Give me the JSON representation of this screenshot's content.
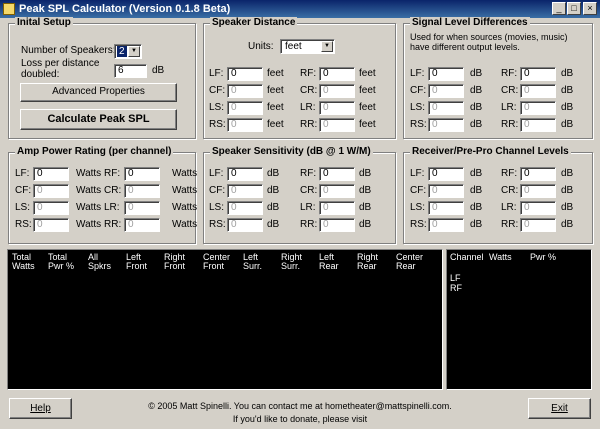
{
  "titlebar": {
    "title": "Peak SPL Calculator (Version 0.1.8 Beta)",
    "minimize": "_",
    "maximize": "□",
    "close": "×"
  },
  "setup": {
    "group_label": "Inital Setup",
    "num_speakers_label": "Number of Speakers:",
    "num_speakers_value": "2",
    "loss_label": "Loss per distance doubled:",
    "loss_value": "6",
    "loss_unit": "dB",
    "advanced_label": "Advanced Properties",
    "calculate_label": "Calculate Peak SPL"
  },
  "distance": {
    "group_label": "Speaker Distance",
    "units_label": "Units:",
    "units_value": "feet",
    "unit": "feet",
    "fields": [
      {
        "label": "LF:",
        "value": "0",
        "enabled": true
      },
      {
        "label": "RF:",
        "value": "0",
        "enabled": true
      },
      {
        "label": "CF:",
        "value": "0",
        "enabled": false
      },
      {
        "label": "CR:",
        "value": "0",
        "enabled": false
      },
      {
        "label": "LS:",
        "value": "0",
        "enabled": false
      },
      {
        "label": "LR:",
        "value": "0",
        "enabled": false
      },
      {
        "label": "RS:",
        "value": "0",
        "enabled": false
      },
      {
        "label": "RR:",
        "value": "0",
        "enabled": false
      }
    ]
  },
  "signal": {
    "group_label": "Signal Level Differences",
    "description": "Used for when sources (movies, music) have different output levels.",
    "unit": "dB",
    "fields": [
      {
        "label": "LF:",
        "value": "0",
        "enabled": true
      },
      {
        "label": "RF:",
        "value": "0",
        "enabled": true
      },
      {
        "label": "CF:",
        "value": "0",
        "enabled": false
      },
      {
        "label": "CR:",
        "value": "0",
        "enabled": false
      },
      {
        "label": "LS:",
        "value": "0",
        "enabled": false
      },
      {
        "label": "LR:",
        "value": "0",
        "enabled": false
      },
      {
        "label": "RS:",
        "value": "0",
        "enabled": false
      },
      {
        "label": "RR:",
        "value": "0",
        "enabled": false
      }
    ]
  },
  "amp": {
    "group_label": "Amp Power Rating  (per channel)",
    "unit": "Watts",
    "fields": [
      {
        "label": "LF:",
        "value": "0",
        "enabled": true
      },
      {
        "label": "RF:",
        "value": "0",
        "enabled": true
      },
      {
        "label": "CF:",
        "value": "0",
        "enabled": false
      },
      {
        "label": "CR:",
        "value": "0",
        "enabled": false
      },
      {
        "label": "LS:",
        "value": "0",
        "enabled": false
      },
      {
        "label": "LR:",
        "value": "0",
        "enabled": false
      },
      {
        "label": "RS:",
        "value": "0",
        "enabled": false
      },
      {
        "label": "RR:",
        "value": "0",
        "enabled": false
      }
    ]
  },
  "sensitivity": {
    "group_label": "Speaker Sensitivity (dB @ 1 W/M)",
    "unit": "dB",
    "fields": [
      {
        "label": "LF:",
        "value": "0",
        "enabled": true
      },
      {
        "label": "RF:",
        "value": "0",
        "enabled": true
      },
      {
        "label": "CF:",
        "value": "0",
        "enabled": false
      },
      {
        "label": "CR:",
        "value": "0",
        "enabled": false
      },
      {
        "label": "LS:",
        "value": "0",
        "enabled": false
      },
      {
        "label": "LR:",
        "value": "0",
        "enabled": false
      },
      {
        "label": "RS:",
        "value": "0",
        "enabled": false
      },
      {
        "label": "RR:",
        "value": "0",
        "enabled": false
      }
    ]
  },
  "receiver": {
    "group_label": "Receiver/Pre-Pro Channel Levels",
    "unit": "dB",
    "fields": [
      {
        "label": "LF:",
        "value": "0",
        "enabled": true
      },
      {
        "label": "RF:",
        "value": "0",
        "enabled": true
      },
      {
        "label": "CF:",
        "value": "0",
        "enabled": false
      },
      {
        "label": "CR:",
        "value": "0",
        "enabled": false
      },
      {
        "label": "LS:",
        "value": "0",
        "enabled": false
      },
      {
        "label": "LR:",
        "value": "0",
        "enabled": false
      },
      {
        "label": "RS:",
        "value": "0",
        "enabled": false
      },
      {
        "label": "RR:",
        "value": "0",
        "enabled": false
      }
    ]
  },
  "results": {
    "headers": [
      "Total\nWatts",
      "Total\nPwr %",
      "All\nSpkrs",
      "Left\nFront",
      "Right\nFront",
      "Center\nFront",
      "Left\nSurr.",
      "Right\nSurr.",
      "Left\nRear",
      "Right\nRear",
      "Center\nRear"
    ]
  },
  "channels": {
    "headers": [
      "Channel",
      "Watts",
      "Pwr %"
    ],
    "rows": [
      "LF",
      "RF"
    ]
  },
  "footer": {
    "help_label": "Help",
    "exit_label": "Exit",
    "copyright": "© 2005 Matt Spinelli. You can contact me at hometheater@mattspinelli.com.",
    "donate": "If you'd like to donate, please visit"
  },
  "colors": {
    "titlebar": "#0a246a",
    "face": "#d4d0c8",
    "panel": "#000000"
  }
}
